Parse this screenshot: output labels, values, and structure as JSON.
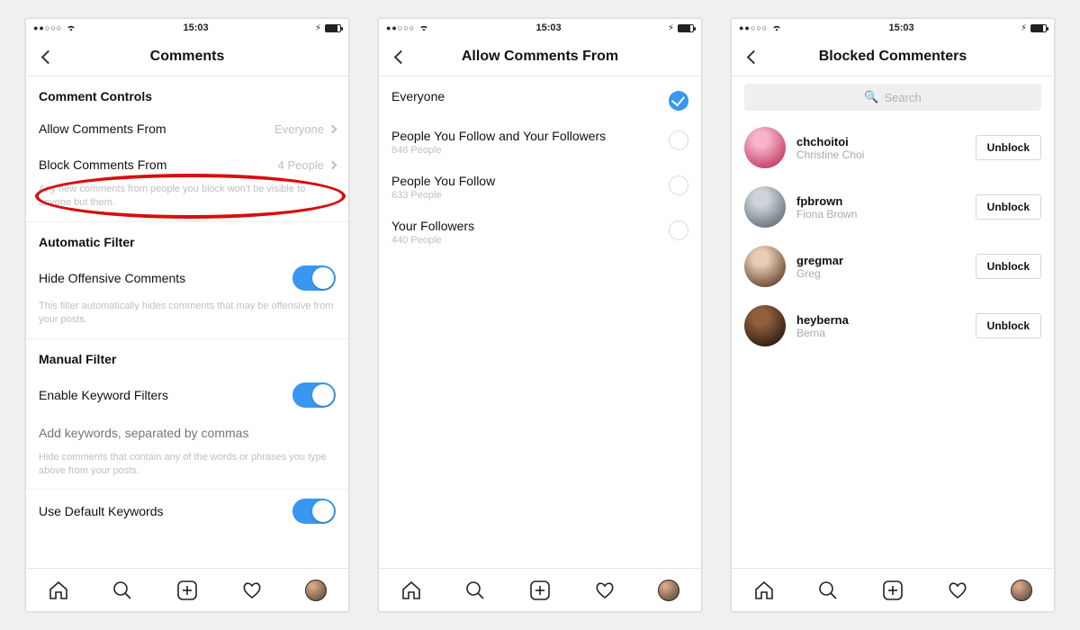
{
  "status": {
    "time": "15:03"
  },
  "screen1": {
    "title": "Comments",
    "section1": "Comment Controls",
    "allow_label": "Allow Comments From",
    "allow_value": "Everyone",
    "block_label": "Block Comments From",
    "block_value": "4 People",
    "block_hint": "Any new comments from people you block won't be visible to anyone but them.",
    "section2": "Automatic Filter",
    "hide_offensive": "Hide Offensive Comments",
    "hide_offensive_hint": "This filter automatically hides comments that may be offensive from your posts.",
    "section3": "Manual Filter",
    "enable_keyword": "Enable Keyword Filters",
    "keywords_placeholder": "Add keywords, separated by commas",
    "keywords_hint": "Hide comments that contain any of the words or phrases you type above from your posts.",
    "default_keywords": "Use Default Keywords"
  },
  "screen2": {
    "title": "Allow Comments From",
    "options": [
      {
        "primary": "Everyone",
        "secondary": "",
        "checked": true
      },
      {
        "primary": "People You Follow and Your Followers",
        "secondary": "848 People",
        "checked": false
      },
      {
        "primary": "People You Follow",
        "secondary": "633 People",
        "checked": false
      },
      {
        "primary": "Your Followers",
        "secondary": "440 People",
        "checked": false
      }
    ]
  },
  "screen3": {
    "title": "Blocked Commenters",
    "search_placeholder": "Search",
    "unblock_label": "Unblock",
    "people": [
      {
        "username": "chchoitoi",
        "realname": "Christine Choi"
      },
      {
        "username": "fpbrown",
        "realname": "Fiona Brown"
      },
      {
        "username": "gregmar",
        "realname": "Greg"
      },
      {
        "username": "heyberna",
        "realname": "Berna"
      }
    ]
  }
}
